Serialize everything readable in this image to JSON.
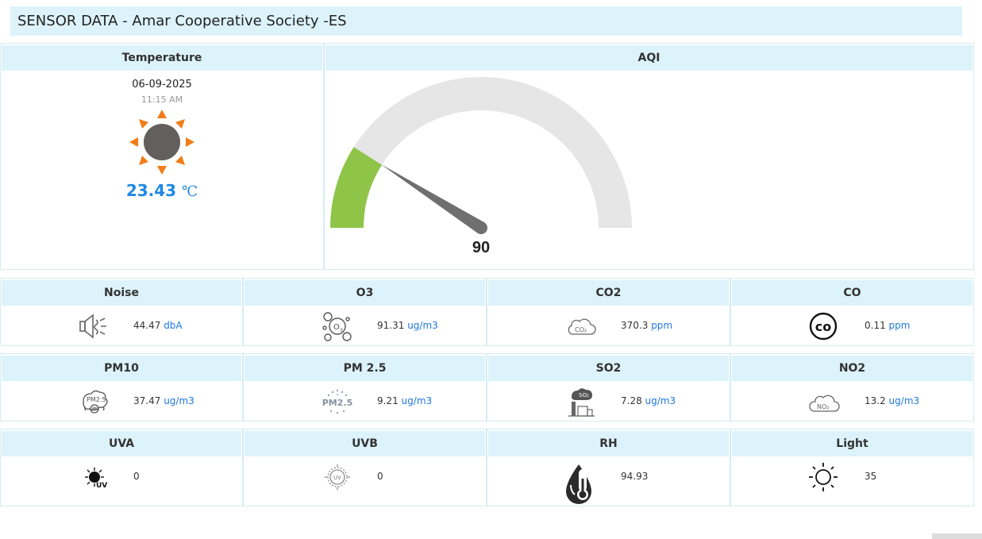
{
  "header": {
    "title": "SENSOR DATA - Amar Cooperative Society -ES"
  },
  "temperature": {
    "title": "Temperature",
    "date": "06-09-2025",
    "time": "11:15 AM",
    "value": "23.43",
    "unit": "℃",
    "icon": "sun-icon"
  },
  "aqi": {
    "title": "AQI",
    "value": 90,
    "max": 500,
    "colors": {
      "fill": "#8ec549",
      "track": "#e6e6e6",
      "needle": "#6f6f6f"
    }
  },
  "sensors": [
    {
      "label": "Noise",
      "value": "44.47",
      "unit": "dbA",
      "icon": "speaker-icon"
    },
    {
      "label": "O3",
      "value": "91.31",
      "unit": "ug/m3",
      "icon": "ozone-icon"
    },
    {
      "label": "CO2",
      "value": "370.3",
      "unit": "ppm",
      "icon": "co2-cloud-icon"
    },
    {
      "label": "CO",
      "value": "0.11",
      "unit": "ppm",
      "icon": "co-icon"
    },
    {
      "label": "PM10",
      "value": "37.47",
      "unit": "ug/m3",
      "icon": "pm10-icon"
    },
    {
      "label": "PM 2.5",
      "value": "9.21",
      "unit": "ug/m3",
      "icon": "pm25-icon"
    },
    {
      "label": "SO2",
      "value": "7.28",
      "unit": "ug/m3",
      "icon": "so2-factory-icon"
    },
    {
      "label": "NO2",
      "value": "13.2",
      "unit": "ug/m3",
      "icon": "no2-cloud-icon"
    },
    {
      "label": "UVA",
      "value": "0",
      "unit": "",
      "icon": "uva-icon"
    },
    {
      "label": "UVB",
      "value": "0",
      "unit": "",
      "icon": "uvb-icon"
    },
    {
      "label": "RH",
      "value": "94.93",
      "unit": "",
      "icon": "thermometer-drop-icon"
    },
    {
      "label": "Light",
      "value": "35",
      "unit": "",
      "icon": "light-sun-icon"
    }
  ]
}
